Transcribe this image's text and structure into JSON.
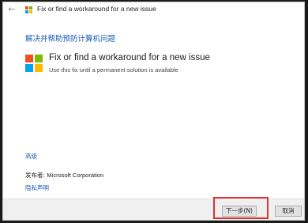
{
  "titlebar": {
    "back_glyph": "←",
    "title": "Fix or find a workaround for a new issue"
  },
  "heading": "解决并帮助预防计算机问题",
  "option": {
    "title": "Fix or find a workaround for a new issue",
    "description": "Use this fix until a permanent solution is available",
    "icon": "microsoft-logo-icon"
  },
  "advanced_link": "高级",
  "publisher": {
    "label": "发布者:",
    "value": "Microsoft Corporation"
  },
  "privacy_link": "隐私声明",
  "buttons": {
    "next": "下一步(N)",
    "cancel": "取消"
  },
  "colors": {
    "link_blue": "#1a5bb5",
    "logo_red": "#f25022",
    "logo_green": "#7fba00",
    "logo_blue": "#00a4ef",
    "logo_yellow": "#ffb900",
    "highlight_red": "#e03030"
  }
}
